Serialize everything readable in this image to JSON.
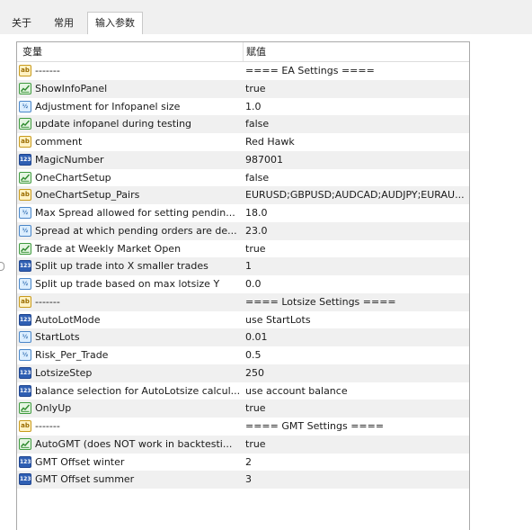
{
  "tabs": [
    {
      "label": "关于"
    },
    {
      "label": "常用"
    },
    {
      "label": "输入参数",
      "active": true
    }
  ],
  "grid": {
    "columns": [
      "变量",
      "赋值"
    ],
    "rows": [
      {
        "icon": "ab",
        "name": "-------",
        "value": "==== EA Settings ===="
      },
      {
        "icon": "bool",
        "name": "ShowInfoPanel",
        "value": "true"
      },
      {
        "icon": "dbl",
        "name": "Adjustment for Infopanel size",
        "value": "1.0"
      },
      {
        "icon": "bool",
        "name": "update infopanel during testing",
        "value": "false"
      },
      {
        "icon": "ab",
        "name": "comment",
        "value": "Red Hawk"
      },
      {
        "icon": "int",
        "name": "MagicNumber",
        "value": "987001"
      },
      {
        "icon": "bool",
        "name": "OneChartSetup",
        "value": "false"
      },
      {
        "icon": "ab",
        "name": "OneChartSetup_Pairs",
        "value": "EURUSD;GBPUSD;AUDCAD;AUDJPY;EURAU..."
      },
      {
        "icon": "dbl",
        "name": "Max Spread allowed for setting pendin...",
        "value": "18.0"
      },
      {
        "icon": "dbl",
        "name": "Spread at which pending orders are de...",
        "value": "23.0"
      },
      {
        "icon": "bool",
        "name": "Trade at Weekly Market Open",
        "value": "true"
      },
      {
        "icon": "int",
        "name": "Split up trade into X smaller trades",
        "value": "1"
      },
      {
        "icon": "dbl",
        "name": "Split up trade based on max lotsize Y",
        "value": "0.0"
      },
      {
        "icon": "ab",
        "name": "-------",
        "value": "==== Lotsize Settings ===="
      },
      {
        "icon": "int",
        "name": "AutoLotMode",
        "value": "use StartLots"
      },
      {
        "icon": "dbl",
        "name": "StartLots",
        "value": "0.01"
      },
      {
        "icon": "dbl",
        "name": "Risk_Per_Trade",
        "value": "0.5"
      },
      {
        "icon": "int",
        "name": "LotsizeStep",
        "value": "250"
      },
      {
        "icon": "int",
        "name": "balance selection for AutoLotsize calcul...",
        "value": "use account balance"
      },
      {
        "icon": "bool",
        "name": "OnlyUp",
        "value": "true"
      },
      {
        "icon": "ab",
        "name": "-------",
        "value": "==== GMT Settings ===="
      },
      {
        "icon": "bool",
        "name": "AutoGMT (does NOT work in backtesti...",
        "value": "true"
      },
      {
        "icon": "int",
        "name": "GMT Offset winter",
        "value": "2"
      },
      {
        "icon": "int",
        "name": "GMT Offset summer",
        "value": "3"
      }
    ]
  }
}
